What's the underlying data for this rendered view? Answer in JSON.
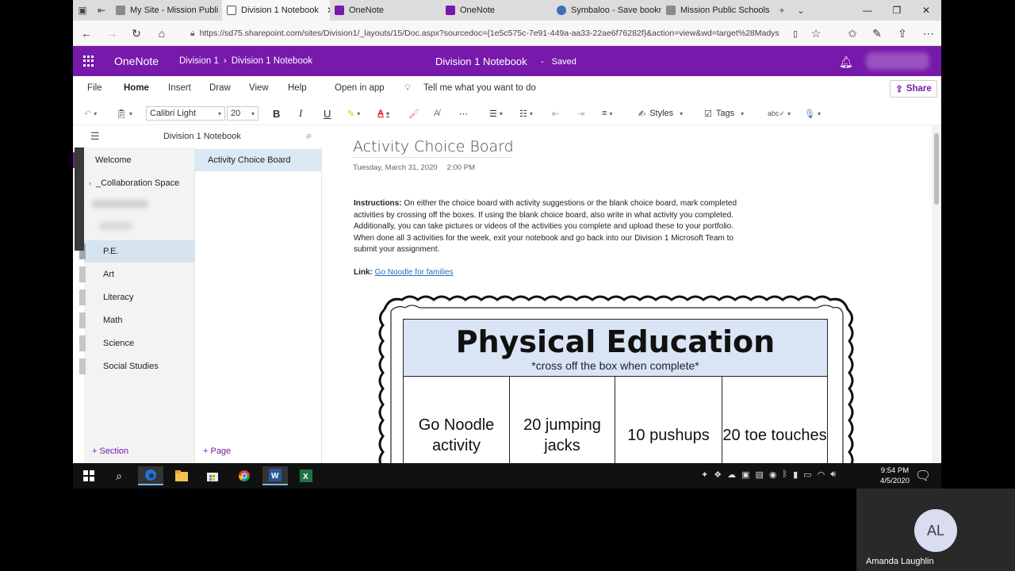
{
  "browser": {
    "tabs": [
      {
        "label": "My Site - Mission Publi",
        "color": "#7a7a7a"
      },
      {
        "label": "Division 1 Notebook",
        "color": "#555",
        "active": true
      },
      {
        "label": "OneNote",
        "color": "#7719aa"
      },
      {
        "label": "OneNote",
        "color": "#7719aa"
      },
      {
        "label": "Symbaloo - Save bookm",
        "color": "#3b6fb6"
      },
      {
        "label": "Mission Public Schools",
        "color": "#7a7a7a"
      }
    ],
    "url": "https://sd75.sharepoint.com/sites/Division1/_layouts/15/Doc.aspx?sourcedoc={1e5c575c-7e91-449a-aa33-22ae6f76282f}&action=view&wd=target%28Madys"
  },
  "onenote": {
    "brand": "OneNote",
    "crumb_1": "Division 1",
    "crumb_sep": "›",
    "crumb_2": "Division 1 Notebook",
    "title": "Division 1 Notebook",
    "title_sep": "-",
    "status": "Saved"
  },
  "menu": {
    "file": "File",
    "home": "Home",
    "insert": "Insert",
    "draw": "Draw",
    "view": "View",
    "help": "Help",
    "open_in_app": "Open in app",
    "tell_me": "Tell me what you want to do",
    "share": "Share"
  },
  "toolbar": {
    "font": "Calibri Light",
    "size": "20",
    "bold": "B",
    "italic": "I",
    "underline": "U",
    "styles": "Styles",
    "tags": "Tags"
  },
  "nav": {
    "notebook_name": "Division 1 Notebook",
    "sections": [
      {
        "label": "Welcome",
        "color": "#7719aa"
      },
      {
        "label": "_Collaboration Space",
        "color": "#555"
      },
      {
        "label": "P.E.",
        "color": "#aaa",
        "selected": true
      },
      {
        "label": "Art",
        "color": "#aaa"
      },
      {
        "label": "Literacy",
        "color": "#aaa"
      },
      {
        "label": "Math",
        "color": "#aaa"
      },
      {
        "label": "Science",
        "color": "#aaa"
      },
      {
        "label": "Social Studies",
        "color": "#aaa"
      }
    ],
    "page": "Activity Choice Board",
    "add_section": "+ Section",
    "add_page": "+ Page"
  },
  "page": {
    "title": "Activity Choice Board",
    "date": "Tuesday, March 31, 2020",
    "time": "2:00 PM",
    "instructions_label": "Instructions:",
    "instructions_text": "On either the choice board with activity suggestions or the blank choice board, mark completed activities by crossing off the boxes. If using the blank choice board, also write in what activity you completed. Additionally, you can take pictures or videos of the activities you complete and upload these to your portfolio. When done all 3 activities for the week, exit your notebook and go back into our Division 1 Microsoft Team to submit your assignment.",
    "link_label": "Link:",
    "link_text": "Go Noodle for families"
  },
  "board": {
    "title": "Physical Education",
    "subtitle": "*cross off the box when complete*",
    "cells": [
      "Go Noodle activity",
      "20 jumping jacks",
      "10 pushups",
      "20 toe touches"
    ]
  },
  "taskbar": {
    "time": "9:54 PM",
    "date": "4/5/2020"
  },
  "meeting": {
    "initials": "AL",
    "name": "Amanda Laughlin"
  }
}
